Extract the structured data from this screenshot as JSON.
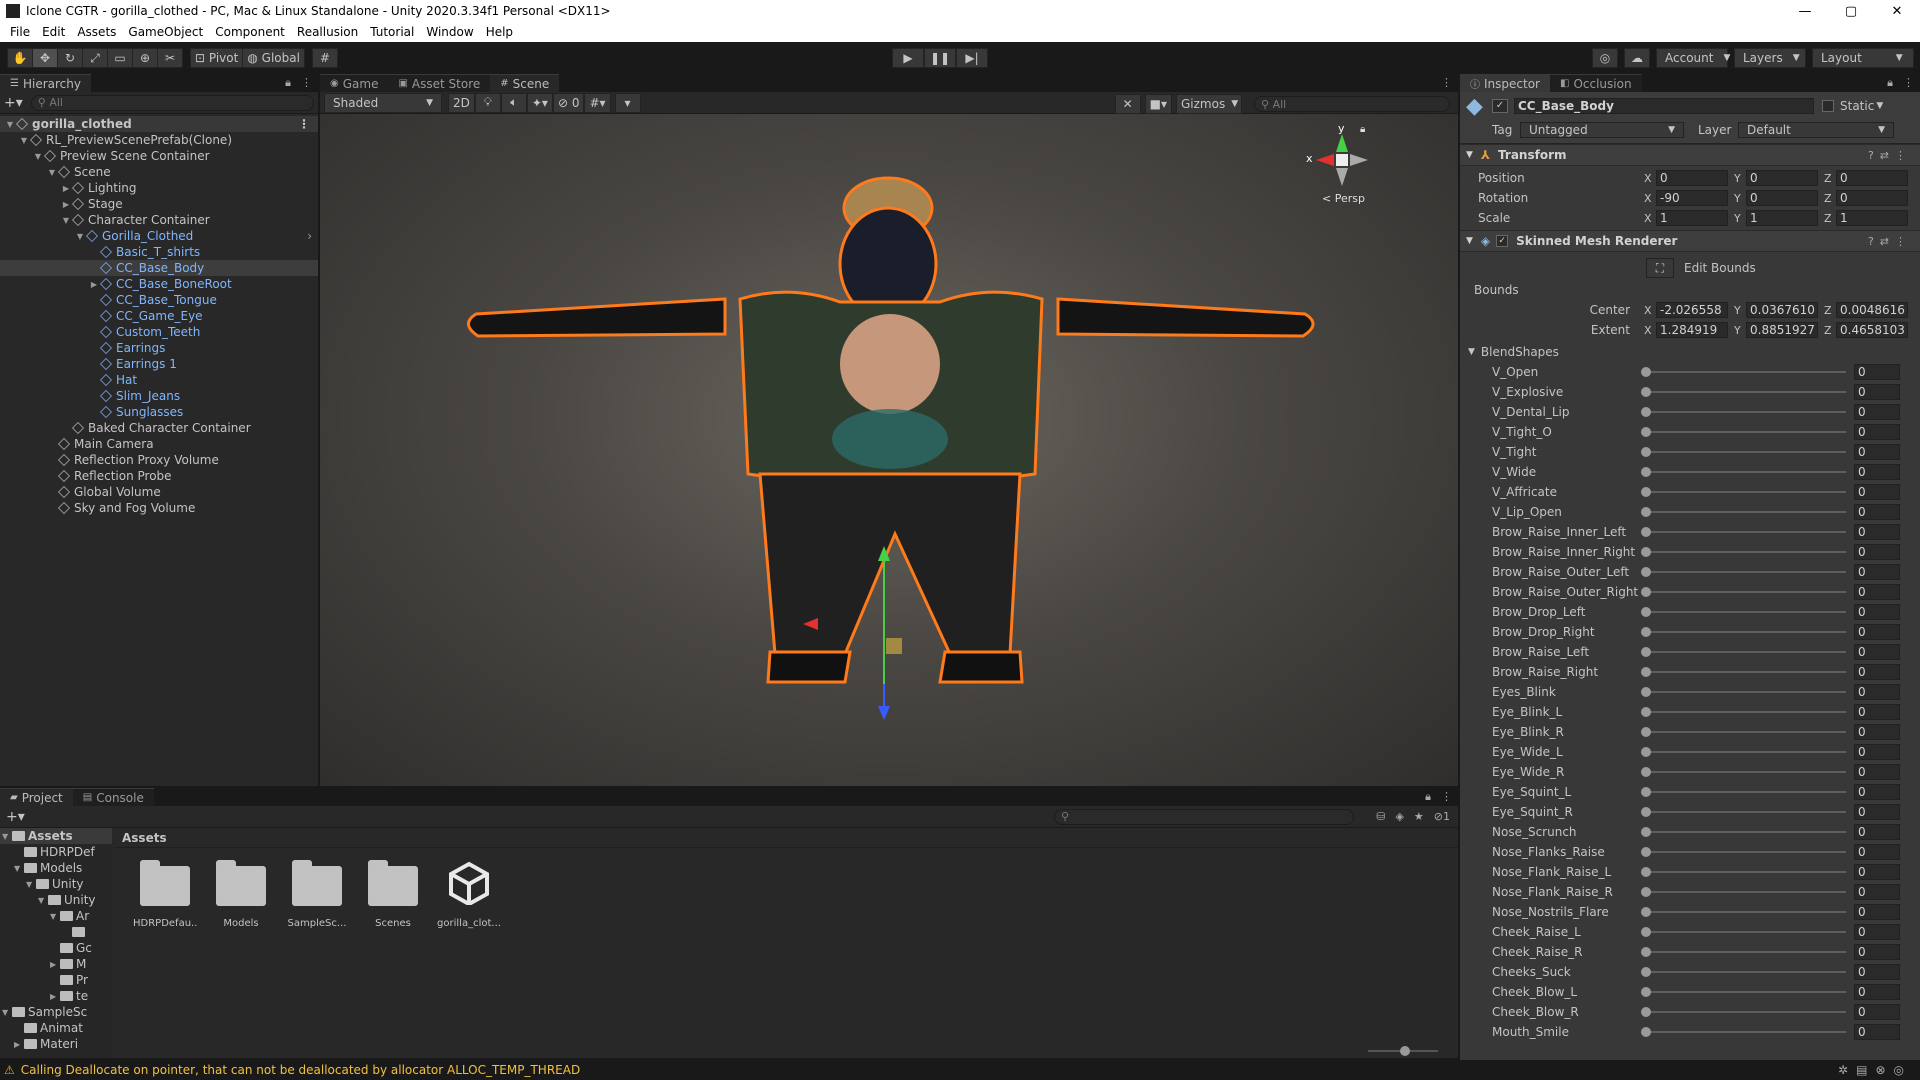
{
  "window": {
    "title": "Iclone CGTR - gorilla_clothed - PC, Mac & Linux Standalone - Unity 2020.3.34f1 Personal <DX11>",
    "controls": [
      "—",
      "▢",
      "✕"
    ]
  },
  "menu": [
    "File",
    "Edit",
    "Assets",
    "GameObject",
    "Component",
    "Reallusion",
    "Tutorial",
    "Window",
    "Help"
  ],
  "toolbar": {
    "pivot_label": "Pivot",
    "global_label": "Global",
    "account_label": "Account",
    "layers_label": "Layers",
    "layout_label": "Layout"
  },
  "hierarchy": {
    "tab_label": "Hierarchy",
    "search_placeholder": "All",
    "items": [
      {
        "label": "gorilla_clothed",
        "depth": 0,
        "arrow": "▼",
        "type": "root"
      },
      {
        "label": "RL_PreviewScenePrefab(Clone)",
        "depth": 1,
        "arrow": "▼",
        "type": "normal"
      },
      {
        "label": "Preview Scene Container",
        "depth": 2,
        "arrow": "▼",
        "type": "normal"
      },
      {
        "label": "Scene",
        "depth": 3,
        "arrow": "▼",
        "type": "normal"
      },
      {
        "label": "Lighting",
        "depth": 4,
        "arrow": "▶",
        "type": "normal"
      },
      {
        "label": "Stage",
        "depth": 4,
        "arrow": "▶",
        "type": "normal"
      },
      {
        "label": "Character Container",
        "depth": 4,
        "arrow": "▼",
        "type": "normal"
      },
      {
        "label": "Gorilla_Clothed",
        "depth": 5,
        "arrow": "▼",
        "type": "blue"
      },
      {
        "label": "Basic_T_shirts",
        "depth": 6,
        "arrow": "",
        "type": "blue"
      },
      {
        "label": "CC_Base_Body",
        "depth": 6,
        "arrow": "",
        "type": "selected"
      },
      {
        "label": "CC_Base_BoneRoot",
        "depth": 6,
        "arrow": "▶",
        "type": "blue"
      },
      {
        "label": "CC_Base_Tongue",
        "depth": 6,
        "arrow": "",
        "type": "blue"
      },
      {
        "label": "CC_Game_Eye",
        "depth": 6,
        "arrow": "",
        "type": "blue"
      },
      {
        "label": "Custom_Teeth",
        "depth": 6,
        "arrow": "",
        "type": "blue"
      },
      {
        "label": "Earrings",
        "depth": 6,
        "arrow": "",
        "type": "blue"
      },
      {
        "label": "Earrings 1",
        "depth": 6,
        "arrow": "",
        "type": "blue"
      },
      {
        "label": "Hat",
        "depth": 6,
        "arrow": "",
        "type": "blue"
      },
      {
        "label": "Slim_Jeans",
        "depth": 6,
        "arrow": "",
        "type": "blue"
      },
      {
        "label": "Sunglasses",
        "depth": 6,
        "arrow": "",
        "type": "blue"
      },
      {
        "label": "Baked Character Container",
        "depth": 4,
        "arrow": "",
        "type": "normal"
      },
      {
        "label": "Main Camera",
        "depth": 3,
        "arrow": "",
        "type": "normal"
      },
      {
        "label": "Reflection Proxy Volume",
        "depth": 3,
        "arrow": "",
        "type": "normal"
      },
      {
        "label": "Reflection Probe",
        "depth": 3,
        "arrow": "",
        "type": "normal"
      },
      {
        "label": "Global Volume",
        "depth": 3,
        "arrow": "",
        "type": "normal"
      },
      {
        "label": "Sky and Fog Volume",
        "depth": 3,
        "arrow": "",
        "type": "normal"
      }
    ]
  },
  "scene": {
    "tabs": [
      "Game",
      "Asset Store",
      "Scene"
    ],
    "shading_mode": "Shaded",
    "mode_2d": "2D",
    "hidden_count": "0",
    "gizmos_label": "Gizmos",
    "search_placeholder": "All",
    "persp_label": "Persp",
    "axis_y": "y",
    "axis_x": "x"
  },
  "inspector": {
    "tabs": [
      "Inspector",
      "Occlusion"
    ],
    "object_name": "CC_Base_Body",
    "static_label": "Static",
    "tag_label": "Tag",
    "tag_value": "Untagged",
    "layer_label": "Layer",
    "layer_value": "Default",
    "transform": {
      "title": "Transform",
      "position": {
        "label": "Position",
        "x": "0",
        "y": "0",
        "z": "0"
      },
      "rotation": {
        "label": "Rotation",
        "x": "-90",
        "y": "0",
        "z": "0"
      },
      "scale": {
        "label": "Scale",
        "x": "1",
        "y": "1",
        "z": "1"
      }
    },
    "smr": {
      "title": "Skinned Mesh Renderer",
      "edit_bounds": "Edit Bounds",
      "bounds_label": "Bounds",
      "center": {
        "label": "Center",
        "x": "-2.026558",
        "y": "0.0367610",
        "z": "0.0048616"
      },
      "extent": {
        "label": "Extent",
        "x": "1.284919",
        "y": "0.8851927",
        "z": "0.4658103"
      }
    },
    "blendshapes_label": "BlendShapes",
    "blendshapes": [
      {
        "name": "V_Open",
        "value": "0"
      },
      {
        "name": "V_Explosive",
        "value": "0"
      },
      {
        "name": "V_Dental_Lip",
        "value": "0"
      },
      {
        "name": "V_Tight_O",
        "value": "0"
      },
      {
        "name": "V_Tight",
        "value": "0"
      },
      {
        "name": "V_Wide",
        "value": "0"
      },
      {
        "name": "V_Affricate",
        "value": "0"
      },
      {
        "name": "V_Lip_Open",
        "value": "0"
      },
      {
        "name": "Brow_Raise_Inner_Left",
        "value": "0"
      },
      {
        "name": "Brow_Raise_Inner_Right",
        "value": "0"
      },
      {
        "name": "Brow_Raise_Outer_Left",
        "value": "0"
      },
      {
        "name": "Brow_Raise_Outer_Right",
        "value": "0"
      },
      {
        "name": "Brow_Drop_Left",
        "value": "0"
      },
      {
        "name": "Brow_Drop_Right",
        "value": "0"
      },
      {
        "name": "Brow_Raise_Left",
        "value": "0"
      },
      {
        "name": "Brow_Raise_Right",
        "value": "0"
      },
      {
        "name": "Eyes_Blink",
        "value": "0"
      },
      {
        "name": "Eye_Blink_L",
        "value": "0"
      },
      {
        "name": "Eye_Blink_R",
        "value": "0"
      },
      {
        "name": "Eye_Wide_L",
        "value": "0"
      },
      {
        "name": "Eye_Wide_R",
        "value": "0"
      },
      {
        "name": "Eye_Squint_L",
        "value": "0"
      },
      {
        "name": "Eye_Squint_R",
        "value": "0"
      },
      {
        "name": "Nose_Scrunch",
        "value": "0"
      },
      {
        "name": "Nose_Flanks_Raise",
        "value": "0"
      },
      {
        "name": "Nose_Flank_Raise_L",
        "value": "0"
      },
      {
        "name": "Nose_Flank_Raise_R",
        "value": "0"
      },
      {
        "name": "Nose_Nostrils_Flare",
        "value": "0"
      },
      {
        "name": "Cheek_Raise_L",
        "value": "0"
      },
      {
        "name": "Cheek_Raise_R",
        "value": "0"
      },
      {
        "name": "Cheeks_Suck",
        "value": "0"
      },
      {
        "name": "Cheek_Blow_L",
        "value": "0"
      },
      {
        "name": "Cheek_Blow_R",
        "value": "0"
      },
      {
        "name": "Mouth_Smile",
        "value": "0"
      }
    ]
  },
  "project": {
    "tabs": [
      "Project",
      "Console"
    ],
    "hidden_count": "1",
    "breadcrumb": "Assets",
    "tree": [
      {
        "label": "Assets",
        "depth": 0,
        "arrow": "▼",
        "bold": true
      },
      {
        "label": "HDRPDef",
        "depth": 1,
        "arrow": ""
      },
      {
        "label": "Models",
        "depth": 1,
        "arrow": "▼"
      },
      {
        "label": "Unity",
        "depth": 2,
        "arrow": "▼"
      },
      {
        "label": "Unity",
        "depth": 3,
        "arrow": "▼"
      },
      {
        "label": "Ar",
        "depth": 4,
        "arrow": "▼"
      },
      {
        "label": "",
        "depth": 5,
        "arrow": ""
      },
      {
        "label": "Gc",
        "depth": 4,
        "arrow": ""
      },
      {
        "label": "M",
        "depth": 4,
        "arrow": "▶"
      },
      {
        "label": "Pr",
        "depth": 4,
        "arrow": ""
      },
      {
        "label": "te",
        "depth": 4,
        "arrow": "▶"
      },
      {
        "label": "SampleSc",
        "depth": 0,
        "arrow": "▼"
      },
      {
        "label": "Animat",
        "depth": 1,
        "arrow": ""
      },
      {
        "label": "Materi",
        "depth": 1,
        "arrow": "▶"
      }
    ],
    "assets": [
      {
        "name": "HDRPDefau...",
        "kind": "folder"
      },
      {
        "name": "Models",
        "kind": "folder"
      },
      {
        "name": "SampleSc...",
        "kind": "folder"
      },
      {
        "name": "Scenes",
        "kind": "folder"
      },
      {
        "name": "gorilla_clot...",
        "kind": "unity-scene"
      }
    ]
  },
  "status": {
    "message": "Calling Deallocate on pointer, that can not be deallocated by allocator ALLOC_TEMP_THREAD"
  },
  "colors": {
    "selection_outline": "#ff7a1a",
    "prefab_blue": "#7fb6ff",
    "warning": "#f4b400"
  }
}
